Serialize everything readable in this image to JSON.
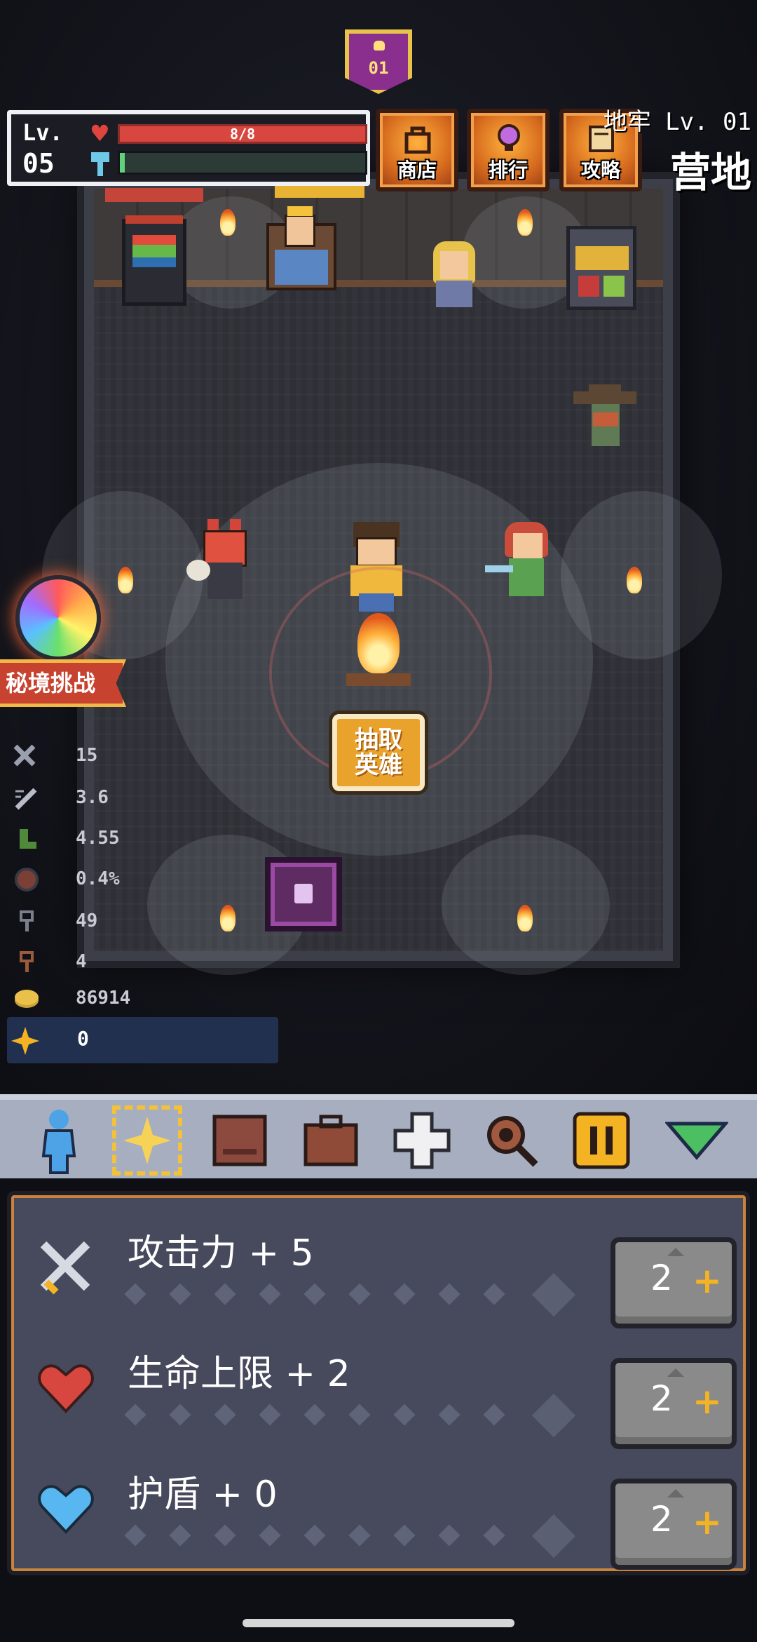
{
  "dungeon": {
    "floor_label": "地牢 Lv. 01",
    "location": "营地",
    "badge_text": "01"
  },
  "player": {
    "level_label": "Lv.",
    "level": "05",
    "hp_text": "8/8",
    "xp_fraction": 0.02
  },
  "top_buttons": [
    {
      "label": "商店",
      "icon": "bag-icon"
    },
    {
      "label": "排行",
      "icon": "trophy-icon"
    },
    {
      "label": "攻略",
      "icon": "scroll-icon"
    }
  ],
  "secret_challenge": "秘境挑战",
  "draw_hero": "抽取英雄",
  "stats": [
    {
      "icon": "sword-icon",
      "value": "15"
    },
    {
      "icon": "sword-speed-icon",
      "value": "3.6"
    },
    {
      "icon": "boot-icon",
      "value": "4.55"
    },
    {
      "icon": "crit-shield-icon",
      "value": "0.4%"
    },
    {
      "icon": "key-icon",
      "value": "49"
    },
    {
      "icon": "key-copper-icon",
      "value": "4"
    },
    {
      "icon": "gold-coin-icon",
      "value": "86914"
    }
  ],
  "currency": {
    "icon": "star-gem-icon",
    "value": "0"
  },
  "toolbar": [
    {
      "name": "hero-tool",
      "icon": "hero-silhouette-icon"
    },
    {
      "name": "talent-tool",
      "icon": "sparkle-icon"
    },
    {
      "name": "book-tool",
      "icon": "book-icon"
    },
    {
      "name": "bag-tool",
      "icon": "briefcase-icon"
    },
    {
      "name": "health-tool",
      "icon": "cross-icon"
    },
    {
      "name": "search-tool",
      "icon": "magnifier-icon"
    },
    {
      "name": "pause-tool",
      "icon": "pause-icon"
    },
    {
      "name": "collapse-tool",
      "icon": "triangle-down-icon"
    }
  ],
  "upgrades": [
    {
      "label": "攻击力 + 5",
      "icon": "sword-icon",
      "cost": "2",
      "progress": 0
    },
    {
      "label": "生命上限 + 2",
      "icon": "heart-icon",
      "cost": "2",
      "progress": 0
    },
    {
      "label": "护盾 + 0",
      "icon": "blue-heart-icon",
      "cost": "2",
      "progress": 0
    }
  ],
  "colors": {
    "hp": "#d8473f",
    "xp": "#61d17b",
    "accent": "#f3b323",
    "panel": "#464a5c"
  }
}
